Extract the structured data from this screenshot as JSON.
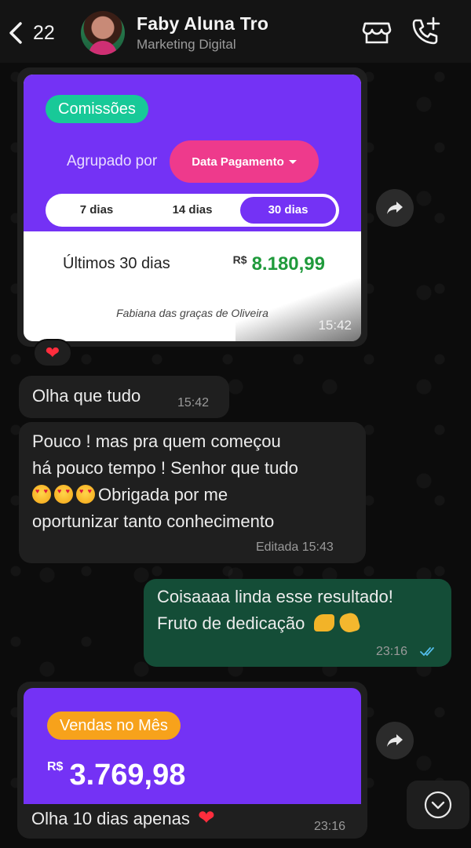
{
  "header": {
    "back_count": "22",
    "contact_name": "Faby Aluna Tro",
    "contact_subtitle": "Marketing Digital"
  },
  "card1": {
    "pill": "Comissões",
    "group_label": "Agrupado por",
    "group_value": "Data Pagamento",
    "tabs": [
      "7 dias",
      "14 dias",
      "30 dias"
    ],
    "active_tab": "30 dias",
    "period_label": "Últimos 30 dias",
    "currency": "R$",
    "amount": "8.180,99",
    "student_name": "Fabiana das graças de Oliveira",
    "time": "15:42",
    "reaction": "❤️"
  },
  "messages": [
    {
      "text": "Olha que tudo",
      "time": "15:42"
    },
    {
      "lines": [
        "Pouco ! mas pra quem começou",
        "há pouco tempo ! Senhor que tudo",
        "Obrigada por me",
        "oportunizar  tanto conhecimento"
      ],
      "emoji": "😍😍😍",
      "edited_label": "Editada",
      "time": "15:43"
    },
    {
      "lines": [
        "Coisaaaa linda esse resultado!",
        "Fruto de dedicação"
      ],
      "emoji": "💪👏",
      "time": "23:16",
      "status": "read"
    }
  ],
  "card2": {
    "pill": "Vendas no Mês",
    "currency": "R$",
    "amount": "3.769,98",
    "caption": "Olha 10 dias apenas",
    "emoji": "❤️",
    "time": "23:16"
  },
  "colors": {
    "purple": "#7432f5",
    "green_pill": "#18c998",
    "pink_select": "#ee3a8c",
    "orange_pill": "#f7a21b",
    "outgoing_bubble": "#144d37",
    "incoming_bubble": "#1f1f1f",
    "read_ticks": "#53bdeb"
  }
}
